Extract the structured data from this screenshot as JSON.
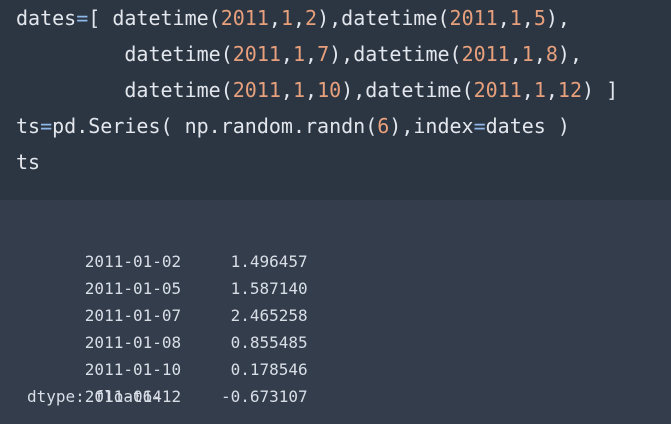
{
  "colors": {
    "code_background": "#2c3643",
    "output_background": "#333d4c",
    "code_text": "#e3e7ed",
    "operator": "#8fb7e8",
    "number": "#e8a07c",
    "output_text": "#d9dee6"
  },
  "code": {
    "lines": [
      [
        {
          "t": "dates",
          "k": "plain"
        },
        {
          "t": "=",
          "k": "op"
        },
        {
          "t": "[ datetime(",
          "k": "plain"
        },
        {
          "t": "2011",
          "k": "num"
        },
        {
          "t": ",",
          "k": "plain"
        },
        {
          "t": "1",
          "k": "num"
        },
        {
          "t": ",",
          "k": "plain"
        },
        {
          "t": "2",
          "k": "num"
        },
        {
          "t": "),datetime(",
          "k": "plain"
        },
        {
          "t": "2011",
          "k": "num"
        },
        {
          "t": ",",
          "k": "plain"
        },
        {
          "t": "1",
          "k": "num"
        },
        {
          "t": ",",
          "k": "plain"
        },
        {
          "t": "5",
          "k": "num"
        },
        {
          "t": "),",
          "k": "plain"
        }
      ],
      [
        {
          "t": "         datetime(",
          "k": "plain"
        },
        {
          "t": "2011",
          "k": "num"
        },
        {
          "t": ",",
          "k": "plain"
        },
        {
          "t": "1",
          "k": "num"
        },
        {
          "t": ",",
          "k": "plain"
        },
        {
          "t": "7",
          "k": "num"
        },
        {
          "t": "),datetime(",
          "k": "plain"
        },
        {
          "t": "2011",
          "k": "num"
        },
        {
          "t": ",",
          "k": "plain"
        },
        {
          "t": "1",
          "k": "num"
        },
        {
          "t": ",",
          "k": "plain"
        },
        {
          "t": "8",
          "k": "num"
        },
        {
          "t": "),",
          "k": "plain"
        }
      ],
      [
        {
          "t": "         datetime(",
          "k": "plain"
        },
        {
          "t": "2011",
          "k": "num"
        },
        {
          "t": ",",
          "k": "plain"
        },
        {
          "t": "1",
          "k": "num"
        },
        {
          "t": ",",
          "k": "plain"
        },
        {
          "t": "10",
          "k": "num"
        },
        {
          "t": "),datetime(",
          "k": "plain"
        },
        {
          "t": "2011",
          "k": "num"
        },
        {
          "t": ",",
          "k": "plain"
        },
        {
          "t": "1",
          "k": "num"
        },
        {
          "t": ",",
          "k": "plain"
        },
        {
          "t": "12",
          "k": "num"
        },
        {
          "t": ") ]",
          "k": "plain"
        }
      ],
      [
        {
          "t": "ts",
          "k": "plain"
        },
        {
          "t": "=",
          "k": "op"
        },
        {
          "t": "pd.Series( np.random.randn(",
          "k": "plain"
        },
        {
          "t": "6",
          "k": "num"
        },
        {
          "t": "),index",
          "k": "plain"
        },
        {
          "t": "=",
          "k": "op"
        },
        {
          "t": "dates )",
          "k": "plain"
        }
      ],
      [
        {
          "t": "ts",
          "k": "plain"
        }
      ]
    ]
  },
  "output": {
    "rows": [
      {
        "date": "2011-01-02",
        "value": "1.496457"
      },
      {
        "date": "2011-01-05",
        "value": "1.587140"
      },
      {
        "date": "2011-01-07",
        "value": "2.465258"
      },
      {
        "date": "2011-01-08",
        "value": "0.855485"
      },
      {
        "date": "2011-01-10",
        "value": "0.178546"
      },
      {
        "date": "2011-01-12",
        "value": "-0.673107"
      }
    ],
    "dtype_line": "dtype: float64"
  }
}
